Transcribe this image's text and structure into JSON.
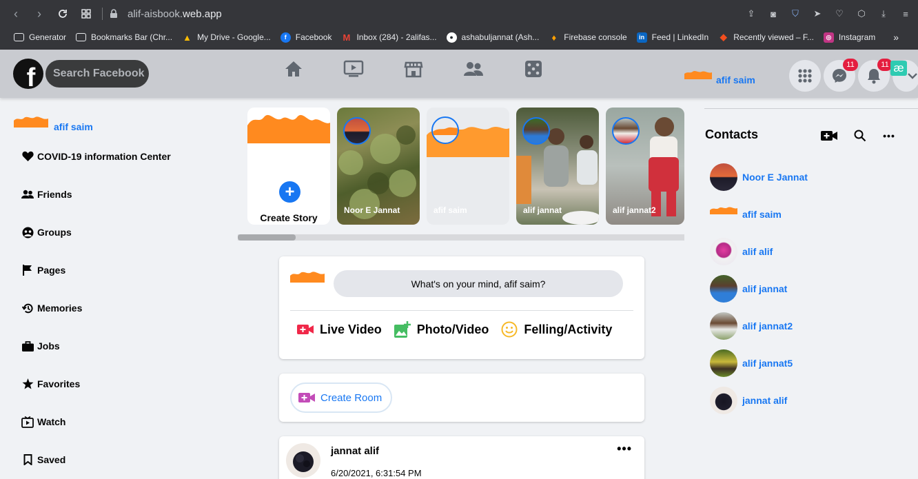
{
  "browser": {
    "url_prefix": "alif-aisbook.",
    "url_domain": "web.app",
    "bookmarks": [
      {
        "label": "Generator",
        "icon": "folder-icon",
        "color": "#e8eaed"
      },
      {
        "label": "Bookmarks Bar (Chr...",
        "icon": "folder-icon",
        "color": "#e8eaed"
      },
      {
        "label": "My Drive - Google...",
        "icon": "google-drive-icon",
        "color": "#fbbc04"
      },
      {
        "label": "Facebook",
        "icon": "facebook-icon",
        "color": "#1877f2"
      },
      {
        "label": "Inbox (284) - 2alifas...",
        "icon": "gmail-icon",
        "color": "#ea4335"
      },
      {
        "label": "ashabuljannat (Ash...",
        "icon": "github-icon",
        "color": "#ffffff"
      },
      {
        "label": "Firebase console",
        "icon": "firebase-icon",
        "color": "#ffa000"
      },
      {
        "label": "Feed | LinkedIn",
        "icon": "linkedin-icon",
        "color": "#0a66c2"
      },
      {
        "label": "Recently viewed – F...",
        "icon": "figma-icon",
        "color": "#f24e1e"
      },
      {
        "label": "Instagram",
        "icon": "instagram-icon",
        "color": "#c13584"
      }
    ],
    "more_label": "»"
  },
  "header": {
    "logo_letter": "f",
    "search_placeholder": "Search Facebook",
    "user_name": "afif saim",
    "messenger_badge": "11",
    "notifications_badge": "11",
    "ext_badge": "æ"
  },
  "sidebar": {
    "user_name": "afif saim",
    "items": [
      {
        "label": "COVID-19 information Center",
        "icon": "heart-icon"
      },
      {
        "label": "Friends",
        "icon": "friends-icon"
      },
      {
        "label": "Groups",
        "icon": "groups-icon"
      },
      {
        "label": "Pages",
        "icon": "flag-icon"
      },
      {
        "label": "Memories",
        "icon": "history-icon"
      },
      {
        "label": "Jobs",
        "icon": "briefcase-icon"
      },
      {
        "label": "Favorites",
        "icon": "star-icon"
      },
      {
        "label": "Watch",
        "icon": "watch-icon"
      },
      {
        "label": "Saved",
        "icon": "bookmark-icon"
      }
    ]
  },
  "stories": {
    "create_label": "Create Story",
    "items": [
      {
        "name": "Noor E Jannat"
      },
      {
        "name": "afif saim"
      },
      {
        "name": "alif jannat"
      },
      {
        "name": "alif jannat2"
      }
    ]
  },
  "composer": {
    "prompt": "What's on your mind, afif saim?",
    "live_video": "Live Video",
    "photo_video": "Photo/Video",
    "feeling": "Felling/Activity"
  },
  "room": {
    "label": "Create Room"
  },
  "post": {
    "author": "jannat alif",
    "timestamp": "6/20/2021, 6:31:54 PM",
    "more": "•••"
  },
  "contacts": {
    "title": "Contacts",
    "more": "•••",
    "items": [
      {
        "name": "Noor E Jannat"
      },
      {
        "name": "afif saim"
      },
      {
        "name": "alif alif"
      },
      {
        "name": "alif jannat"
      },
      {
        "name": "alif jannat2"
      },
      {
        "name": "alif jannat5"
      },
      {
        "name": "jannat alif"
      }
    ]
  }
}
